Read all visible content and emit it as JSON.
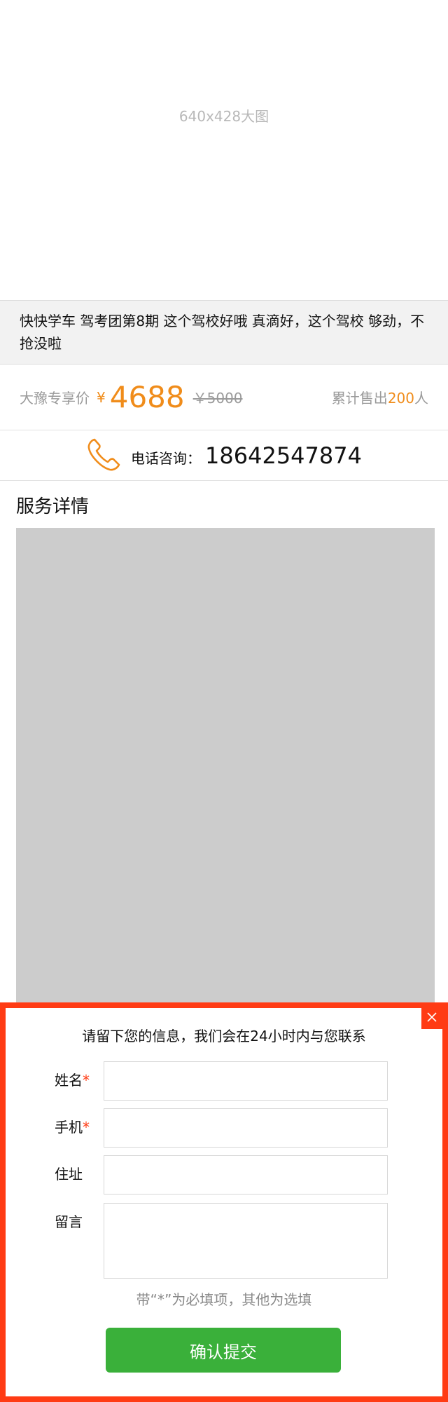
{
  "hero": {
    "placeholder_text": "640x428大图"
  },
  "product": {
    "title": "快快学车 驾考团第8期 这个驾校好哦 真滴好，这个驾校 够劲，不抢没啦",
    "price_label": "大豫专享价",
    "currency_symbol": "¥",
    "price": "4688",
    "original_price": "￥5000",
    "sold_prefix": "累计售出",
    "sold_count": "200",
    "sold_suffix": "人"
  },
  "contact": {
    "label": "电话咨询：",
    "phone": "18642547874",
    "icon": "phone-icon",
    "icon_color": "#f08c1a"
  },
  "service": {
    "section_title": "服务详情"
  },
  "modal": {
    "heading": "请留下您的信息，我们会在24小时内与您联系",
    "fields": [
      {
        "label": "姓名",
        "required_mark": "*",
        "value": ""
      },
      {
        "label": "手机",
        "required_mark": "*",
        "value": ""
      },
      {
        "label": "住址",
        "value": ""
      },
      {
        "label": "留言",
        "value": ""
      }
    ],
    "hint": "带“*”为必填项，其他为选填",
    "submit_label": "确认提交",
    "close_icon": "close-icon"
  },
  "colors": {
    "accent": "#f08c1a",
    "modal_border": "#ff3b14",
    "submit_button": "#3ab03a"
  }
}
